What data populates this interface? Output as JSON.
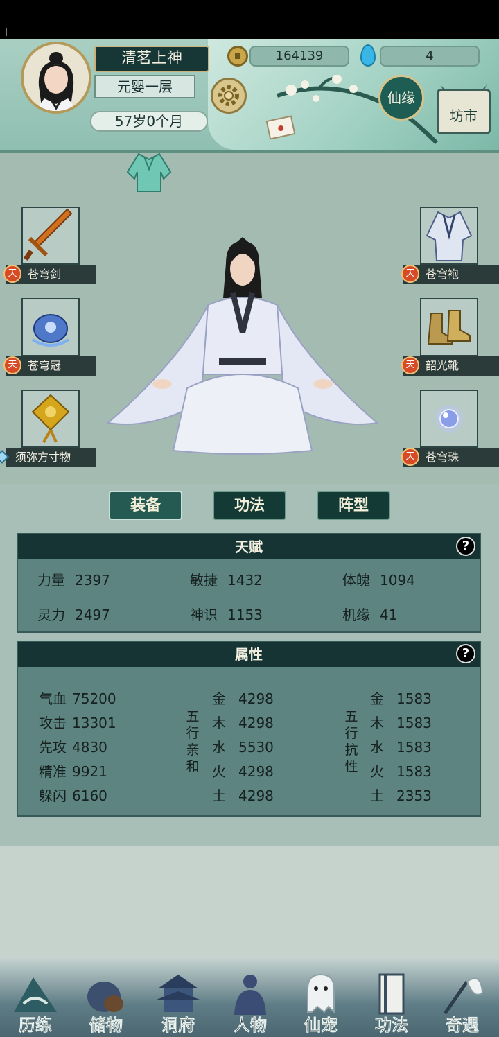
{
  "player": {
    "name": "清茗上神",
    "realm": "元婴一层",
    "age": "57岁0个月"
  },
  "currency": {
    "coins": "164139",
    "gems": "4"
  },
  "header_buttons": {
    "xianyuan": "仙缘",
    "fangshi": "坊市"
  },
  "equipment": {
    "weapon": "苍穹剑",
    "helmet": "苍穹冠",
    "accessory": "须弥方寸物",
    "robe": "苍穹袍",
    "boots": "韶光靴",
    "orb": "苍穹珠",
    "badge": "天"
  },
  "tabs": [
    "装备",
    "功法",
    "阵型"
  ],
  "talent": {
    "title": "天赋",
    "help": "?",
    "stats": [
      {
        "label": "力量",
        "value": "2397"
      },
      {
        "label": "敏捷",
        "value": "1432"
      },
      {
        "label": "体魄",
        "value": "1094"
      },
      {
        "label": "灵力",
        "value": "2497"
      },
      {
        "label": "神识",
        "value": "1153"
      },
      {
        "label": "机缘",
        "value": "41"
      }
    ]
  },
  "attributes": {
    "title": "属性",
    "help": "?",
    "base": [
      {
        "label": "气血",
        "value": "75200"
      },
      {
        "label": "攻击",
        "value": "13301"
      },
      {
        "label": "先攻",
        "value": "4830"
      },
      {
        "label": "精准",
        "value": "9921"
      },
      {
        "label": "躲闪",
        "value": "6160"
      }
    ],
    "affinity_label": "五行亲和",
    "affinity": [
      {
        "label": "金",
        "value": "4298"
      },
      {
        "label": "木",
        "value": "4298"
      },
      {
        "label": "水",
        "value": "5530"
      },
      {
        "label": "火",
        "value": "4298"
      },
      {
        "label": "土",
        "value": "4298"
      }
    ],
    "resist_label": "五行抗性",
    "resist": [
      {
        "label": "金",
        "value": "1583"
      },
      {
        "label": "木",
        "value": "1583"
      },
      {
        "label": "水",
        "value": "1583"
      },
      {
        "label": "火",
        "value": "1583"
      },
      {
        "label": "土",
        "value": "2353"
      }
    ]
  },
  "nav": [
    "历练",
    "储物",
    "洞府",
    "人物",
    "仙宠",
    "功法",
    "奇遇"
  ]
}
